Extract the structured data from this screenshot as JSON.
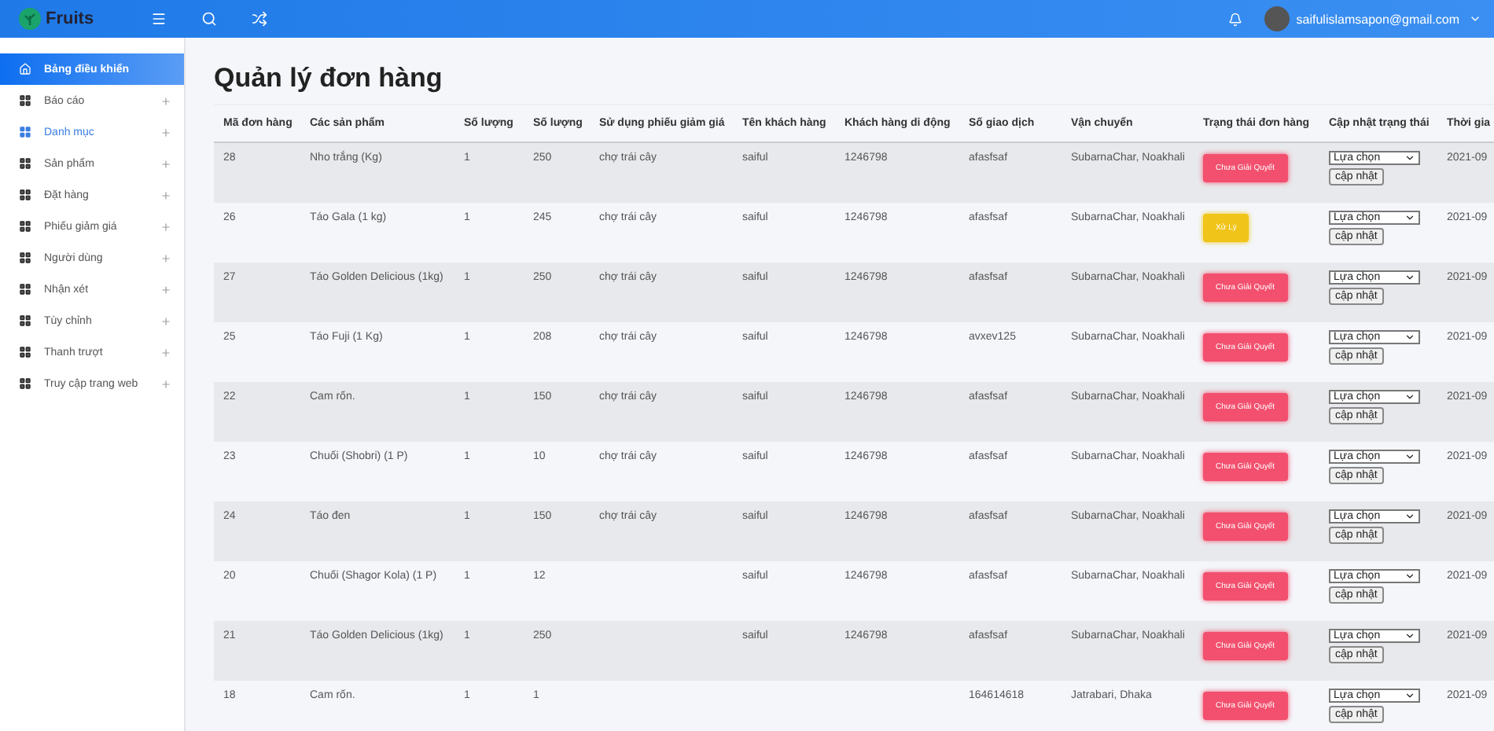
{
  "topbar": {
    "logo": "Fruits",
    "email": "saifulislamsapon@gmail.com"
  },
  "sidebar": {
    "items": [
      {
        "label": "Bảng điều khiển",
        "selected": true,
        "hovered": false,
        "has_submenu": false
      },
      {
        "label": "Báo cáo",
        "selected": false,
        "hovered": false,
        "has_submenu": true
      },
      {
        "label": "Danh mục",
        "selected": false,
        "hovered": true,
        "has_submenu": true
      },
      {
        "label": "Sản phẩm",
        "selected": false,
        "hovered": false,
        "has_submenu": true
      },
      {
        "label": "Đặt hàng",
        "selected": false,
        "hovered": false,
        "has_submenu": true
      },
      {
        "label": "Phiếu giảm giá",
        "selected": false,
        "hovered": false,
        "has_submenu": true
      },
      {
        "label": "Người dùng",
        "selected": false,
        "hovered": false,
        "has_submenu": true
      },
      {
        "label": "Nhận xét",
        "selected": false,
        "hovered": false,
        "has_submenu": true
      },
      {
        "label": "Tùy chỉnh",
        "selected": false,
        "hovered": false,
        "has_submenu": true
      },
      {
        "label": "Thanh trượt",
        "selected": false,
        "hovered": false,
        "has_submenu": true
      },
      {
        "label": "Truy cập trang web",
        "selected": false,
        "hovered": false,
        "has_submenu": true
      }
    ]
  },
  "page_title": "Quản lý đơn hàng",
  "table": {
    "columns": [
      "Mã đơn hàng",
      "Các sản phẩm",
      "Số lượng",
      "Số lượng",
      "Sử dụng phiếu giảm giá",
      "Tên khách hàng",
      "Khách hàng di động",
      "Số giao dịch",
      "Vận chuyển",
      "Trạng thái đơn hàng",
      "Cập nhật trạng thái",
      "Thời gia"
    ],
    "rows": [
      {
        "cells": [
          "28",
          "Nho trắng (Kg)",
          "1",
          "250",
          "chợ trái cây",
          "saiful",
          "1246798",
          "afasfsaf",
          "SubarnaChar, Noakhali"
        ],
        "status": {
          "kind": "pending",
          "label": "Chưa Giải Quyết"
        },
        "select_placeholder": "Lựa chọn",
        "update_label": "cập nhật",
        "time": "2021-09"
      },
      {
        "cells": [
          "26",
          "Táo Gala (1 kg)",
          "1",
          "245",
          "chợ trái cây",
          "saiful",
          "1246798",
          "afasfsaf",
          "SubarnaChar, Noakhali"
        ],
        "status": {
          "kind": "processing",
          "label": "Xử Lý"
        },
        "select_placeholder": "Lựa chọn",
        "update_label": "cập nhật",
        "time": "2021-09"
      },
      {
        "cells": [
          "27",
          "Táo Golden Delicious (1kg)",
          "1",
          "250",
          "chợ trái cây",
          "saiful",
          "1246798",
          "afasfsaf",
          "SubarnaChar, Noakhali"
        ],
        "status": {
          "kind": "pending",
          "label": "Chưa Giải Quyết"
        },
        "select_placeholder": "Lựa chọn",
        "update_label": "cập nhật",
        "time": "2021-09"
      },
      {
        "cells": [
          "25",
          "Táo Fuji (1 Kg)",
          "1",
          "208",
          "chợ trái cây",
          "saiful",
          "1246798",
          "avxev125",
          "SubarnaChar, Noakhali"
        ],
        "status": {
          "kind": "pending",
          "label": "Chưa Giải Quyết"
        },
        "select_placeholder": "Lựa chọn",
        "update_label": "cập nhật",
        "time": "2021-09"
      },
      {
        "cells": [
          "22",
          "Cam rốn.",
          "1",
          "150",
          "chợ trái cây",
          "saiful",
          "1246798",
          "afasfsaf",
          "SubarnaChar, Noakhali"
        ],
        "status": {
          "kind": "pending",
          "label": "Chưa Giải Quyết"
        },
        "select_placeholder": "Lựa chọn",
        "update_label": "cập nhật",
        "time": "2021-09"
      },
      {
        "cells": [
          "23",
          "Chuối (Shobri) (1 P)",
          "1",
          "10",
          "chợ trái cây",
          "saiful",
          "1246798",
          "afasfsaf",
          "SubarnaChar, Noakhali"
        ],
        "status": {
          "kind": "pending",
          "label": "Chưa Giải Quyết"
        },
        "select_placeholder": "Lựa chọn",
        "update_label": "cập nhật",
        "time": "2021-09"
      },
      {
        "cells": [
          "24",
          "Táo đen",
          "1",
          "150",
          "chợ trái cây",
          "saiful",
          "1246798",
          "afasfsaf",
          "SubarnaChar, Noakhali"
        ],
        "status": {
          "kind": "pending",
          "label": "Chưa Giải Quyết"
        },
        "select_placeholder": "Lựa chọn",
        "update_label": "cập nhật",
        "time": "2021-09"
      },
      {
        "cells": [
          "20",
          "Chuối (Shagor Kola) (1 P)",
          "1",
          "12",
          "",
          "saiful",
          "1246798",
          "afasfsaf",
          "SubarnaChar, Noakhali"
        ],
        "status": {
          "kind": "pending",
          "label": "Chưa Giải Quyết"
        },
        "select_placeholder": "Lựa chọn",
        "update_label": "cập nhật",
        "time": "2021-09"
      },
      {
        "cells": [
          "21",
          "Táo Golden Delicious (1kg)",
          "1",
          "250",
          "",
          "saiful",
          "1246798",
          "afasfsaf",
          "SubarnaChar, Noakhali"
        ],
        "status": {
          "kind": "pending",
          "label": "Chưa Giải Quyết"
        },
        "select_placeholder": "Lựa chọn",
        "update_label": "cập nhật",
        "time": "2021-09"
      },
      {
        "cells": [
          "18",
          "Cam rốn.",
          "1",
          "1",
          "",
          "",
          "",
          "164614618",
          "Jatrabari, Dhaka"
        ],
        "status": {
          "kind": "pending",
          "label": "Chưa Giải Quyết"
        },
        "select_placeholder": "Lựa chọn",
        "update_label": "cập nhật",
        "time": "2021-09"
      }
    ]
  }
}
